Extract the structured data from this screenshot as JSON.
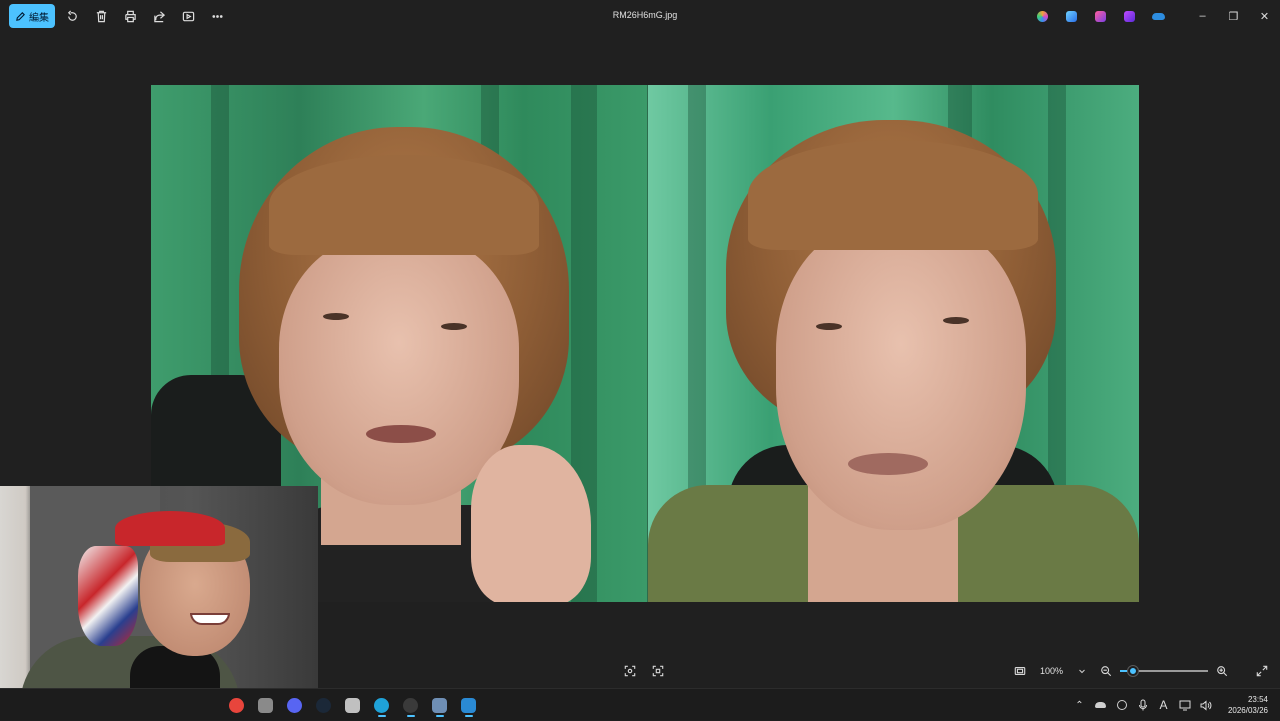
{
  "window": {
    "title": "RM26H6mG.jpg",
    "edit_label": "編集",
    "toolbar_icons": [
      "rotate-icon",
      "delete-icon",
      "print-icon",
      "share-icon",
      "slideshow-icon",
      "more-icon"
    ],
    "app_shortcuts": [
      "copilot-icon",
      "designer-icon",
      "clipchamp-icon",
      "photos-editor-icon",
      "onedrive-icon"
    ],
    "controls": {
      "minimize": "–",
      "restore": "❐",
      "close": "✕"
    }
  },
  "viewer": {
    "zoom_label": "100%",
    "zoom_level_percent": 100,
    "slider_fraction": 0.15,
    "bottom_left_icons": [
      "face-select-icon",
      "face-grid-icon"
    ],
    "bottom_right_icons": [
      "fit-window-icon",
      "zoom-out-icon",
      "zoom-in-icon",
      "fullscreen-icon"
    ]
  },
  "colors": {
    "accent": "#4cc2ff",
    "background": "#202020",
    "taskbar": "#1c1c1c"
  },
  "taskbar": {
    "apps": [
      {
        "name": "chrome-icon",
        "color": "#e8453c"
      },
      {
        "name": "shield-app-icon",
        "color": "#8a8a8a"
      },
      {
        "name": "discord-icon",
        "color": "#5865f2"
      },
      {
        "name": "steam-icon",
        "color": "#1b2838"
      },
      {
        "name": "network-app-icon",
        "color": "#c0c0c0"
      },
      {
        "name": "edge-icon",
        "color": "#1fa2d8"
      },
      {
        "name": "obs-icon",
        "color": "#3a3a3a"
      },
      {
        "name": "camera-icon",
        "color": "#6f8fb5"
      },
      {
        "name": "photos-icon",
        "color": "#2a8ad4"
      }
    ],
    "tray": [
      "chevron-up-icon",
      "onedrive-tray-icon",
      "steam-tray-icon",
      "microphone-icon",
      "ime-icon",
      "display-icon",
      "volume-icon"
    ],
    "ime_label": "A",
    "time": "23:54",
    "date": "2026/03/26"
  }
}
